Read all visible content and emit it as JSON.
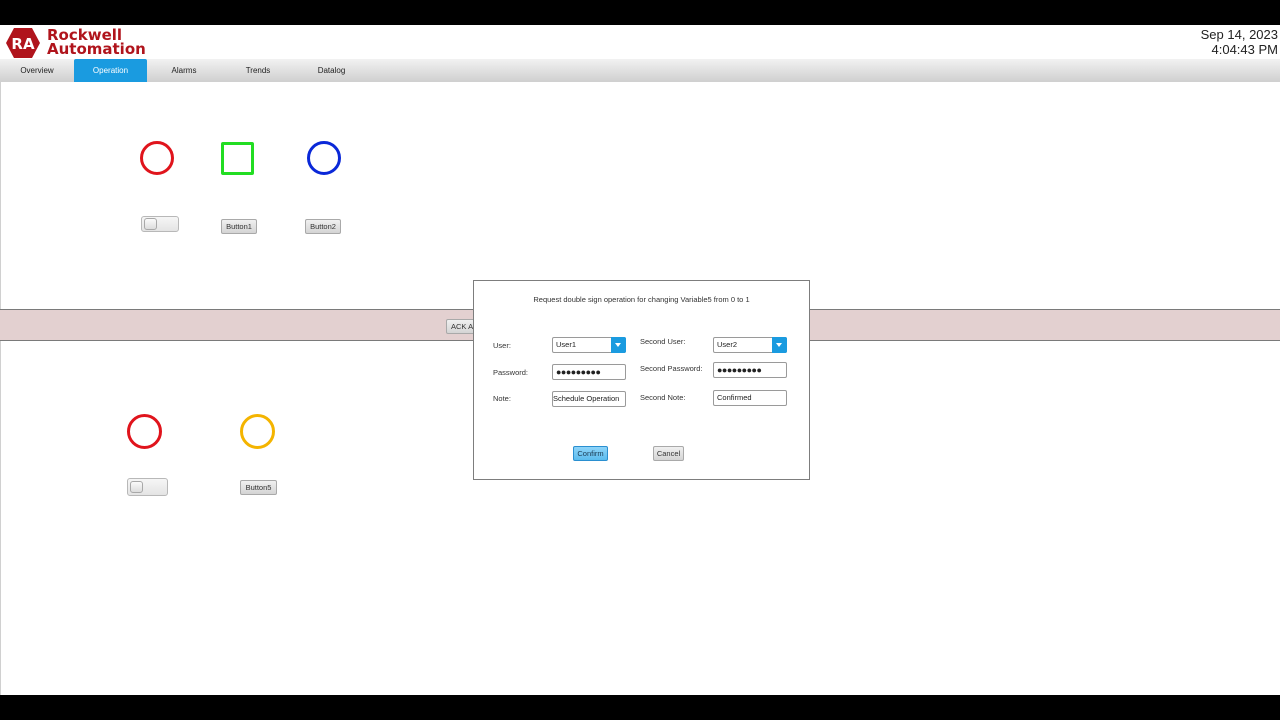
{
  "header": {
    "brand_line1": "Rockwell",
    "brand_line2": "Automation",
    "logo_badge_text": "RA",
    "date": "Sep 14, 2023",
    "time": "4:04:43 PM"
  },
  "tabs": [
    {
      "label": "Overview",
      "active": false
    },
    {
      "label": "Operation",
      "active": true
    },
    {
      "label": "Alarms",
      "active": false
    },
    {
      "label": "Trends",
      "active": false
    },
    {
      "label": "Datalog",
      "active": false
    }
  ],
  "indicators": {
    "top": [
      {
        "shape": "circle",
        "color": "#e0141c"
      },
      {
        "shape": "square",
        "color": "#22dd22"
      },
      {
        "shape": "circle",
        "color": "#0a28d8"
      }
    ],
    "bottom": [
      {
        "shape": "circle",
        "color": "#e0141c"
      },
      {
        "shape": "circle",
        "color": "#f4b400"
      }
    ]
  },
  "controls": {
    "button1": "Button1",
    "button2": "Button2",
    "button5": "Button5"
  },
  "alarm_band": {
    "ack_label": "ACK A"
  },
  "dialog": {
    "title": "Request double sign operation for changing Variable5 from 0 to 1",
    "user_label": "User:",
    "user_value": "User1",
    "password_label": "Password:",
    "password_value": "●●●●●●●●●",
    "note_label": "Note:",
    "note_value": "Schedule Operation",
    "second_user_label": "Second User:",
    "second_user_value": "User2",
    "second_password_label": "Second Password:",
    "second_password_value": "●●●●●●●●●",
    "second_note_label": "Second Note:",
    "second_note_value": "Confirmed",
    "confirm_label": "Confirm",
    "cancel_label": "Cancel"
  },
  "colors": {
    "accent": "#1a9be0",
    "brand": "#b0141c",
    "alarm_band": "#e3d0d0"
  }
}
